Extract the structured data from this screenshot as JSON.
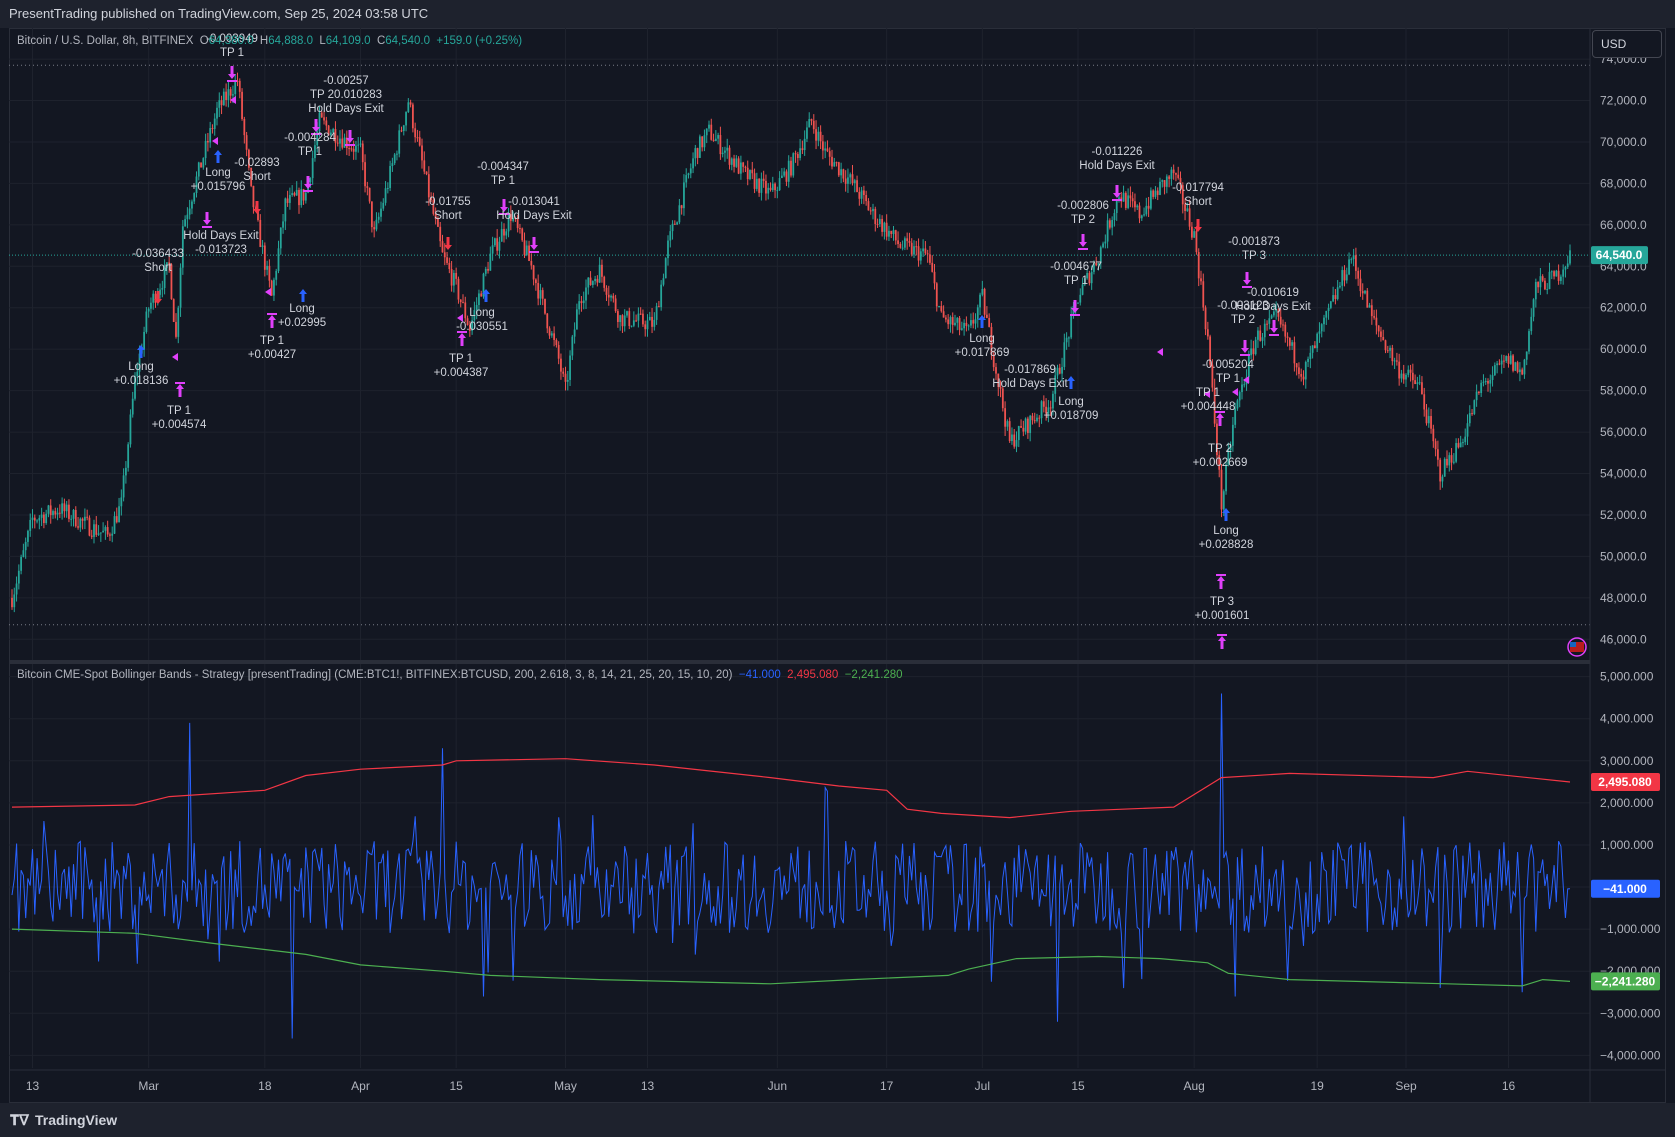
{
  "header": {
    "published": "PresentTrading published on TradingView.com, Sep 25, 2024 03:58 UTC"
  },
  "price_legend": {
    "symbol": "Bitcoin / U.S. Dollar, 8h, BITFINEX",
    "o_label": "O",
    "o_value": "64,380.0",
    "h_label": "H",
    "h_value": "64,888.0",
    "l_label": "L",
    "l_value": "64,109.0",
    "c_label": "C",
    "c_value": "64,540.0",
    "change": "+159.0 (+0.25%)"
  },
  "indicator_legend": {
    "name": "Bitcoin CME-Spot Bollinger Bands - Strategy [presentTrading] (CME:BTC1!, BITFINEX:BTCUSD, 200, 2.618, 3, 8, 14, 21, 25, 20, 15, 10, 20)",
    "value_blue": "−41.000",
    "value_red": "2,495.080",
    "value_green": "−2,241.280"
  },
  "currency_button": "USD",
  "footer": {
    "logo_text": "TradingView"
  },
  "colors": {
    "background": "#131722",
    "up": "#26a69a",
    "down": "#ef5350",
    "grid": "#1e222d",
    "signal_long": "#2962ff",
    "signal_exit": "#e040fb",
    "signal_short": "#f23645",
    "spread": "#2962ff",
    "upper_band": "#f23645",
    "lower_band": "#4caf50"
  },
  "chart_data": [
    {
      "type": "candlestick",
      "title": "Bitcoin / U.S. Dollar, 8h, BITFINEX",
      "ylim": [
        45000,
        75500
      ],
      "y_ticks": [
        "74,000.0",
        "72,000.0",
        "70,000.0",
        "68,000.0",
        "66,000.0",
        "64,000.0",
        "62,000.0",
        "60,000.0",
        "58,000.0",
        "56,000.0",
        "54,000.0",
        "52,000.0",
        "50,000.0",
        "48,000.0",
        "46,000.0"
      ],
      "last_price_label": "64,540.0",
      "x_ticks": [
        "13",
        "Mar",
        "18",
        "Apr",
        "15",
        "May",
        "13",
        "Jun",
        "17",
        "Jul",
        "15",
        "Aug",
        "19",
        "Sep",
        "16"
      ],
      "close_path": [
        [
          "2024-02-10",
          48000
        ],
        [
          "2024-02-13",
          51800
        ],
        [
          "2024-02-17",
          52300
        ],
        [
          "2024-02-21",
          51500
        ],
        [
          "2024-02-24",
          51000
        ],
        [
          "2024-02-26",
          52500
        ],
        [
          "2024-02-28",
          58500
        ],
        [
          "2024-03-01",
          62000
        ],
        [
          "2024-03-04",
          64000
        ],
        [
          "2024-03-05",
          60500
        ],
        [
          "2024-03-06",
          66000
        ],
        [
          "2024-03-08",
          68200
        ],
        [
          "2024-03-11",
          71500
        ],
        [
          "2024-03-14",
          73000
        ],
        [
          "2024-03-16",
          67500
        ],
        [
          "2024-03-19",
          62500
        ],
        [
          "2024-03-21",
          67000
        ],
        [
          "2024-03-24",
          67500
        ],
        [
          "2024-03-26",
          71000
        ],
        [
          "2024-03-28",
          70500
        ],
        [
          "2024-04-01",
          69500
        ],
        [
          "2024-04-03",
          65500
        ],
        [
          "2024-04-05",
          68000
        ],
        [
          "2024-04-08",
          72000
        ],
        [
          "2024-04-10",
          69000
        ],
        [
          "2024-04-13",
          64500
        ],
        [
          "2024-04-15",
          63000
        ],
        [
          "2024-04-17",
          61000
        ],
        [
          "2024-04-20",
          64500
        ],
        [
          "2024-04-23",
          66500
        ],
        [
          "2024-04-26",
          64000
        ],
        [
          "2024-04-30",
          59500
        ],
        [
          "2024-05-01",
          58000
        ],
        [
          "2024-05-03",
          62500
        ],
        [
          "2024-05-06",
          63800
        ],
        [
          "2024-05-09",
          61500
        ],
        [
          "2024-05-14",
          61200
        ],
        [
          "2024-05-16",
          65000
        ],
        [
          "2024-05-20",
          69500
        ],
        [
          "2024-05-22",
          70500
        ],
        [
          "2024-05-27",
          68500
        ],
        [
          "2024-05-31",
          67500
        ],
        [
          "2024-06-03",
          68800
        ],
        [
          "2024-06-06",
          71000
        ],
        [
          "2024-06-08",
          69500
        ],
        [
          "2024-06-12",
          68000
        ],
        [
          "2024-06-15",
          66500
        ],
        [
          "2024-06-19",
          65000
        ],
        [
          "2024-06-23",
          64500
        ],
        [
          "2024-06-25",
          61500
        ],
        [
          "2024-06-29",
          60800
        ],
        [
          "2024-07-01",
          62500
        ],
        [
          "2024-07-05",
          55500
        ],
        [
          "2024-07-08",
          56500
        ],
        [
          "2024-07-11",
          57500
        ],
        [
          "2024-07-15",
          62500
        ],
        [
          "2024-07-18",
          64500
        ],
        [
          "2024-07-21",
          67500
        ],
        [
          "2024-07-24",
          66500
        ],
        [
          "2024-07-27",
          67800
        ],
        [
          "2024-07-29",
          68500
        ],
        [
          "2024-08-01",
          65500
        ],
        [
          "2024-08-03",
          60500
        ],
        [
          "2024-08-05",
          52500
        ],
        [
          "2024-08-07",
          57000
        ],
        [
          "2024-08-10",
          60500
        ],
        [
          "2024-08-13",
          61500
        ],
        [
          "2024-08-17",
          58800
        ],
        [
          "2024-08-20",
          61200
        ],
        [
          "2024-08-24",
          64500
        ],
        [
          "2024-08-27",
          61500
        ],
        [
          "2024-08-31",
          59000
        ],
        [
          "2024-09-03",
          58200
        ],
        [
          "2024-09-06",
          54000
        ],
        [
          "2024-09-09",
          55500
        ],
        [
          "2024-09-12",
          58200
        ],
        [
          "2024-09-16",
          59500
        ],
        [
          "2024-09-18",
          58800
        ],
        [
          "2024-09-20",
          63000
        ],
        [
          "2024-09-23",
          63500
        ],
        [
          "2024-09-25",
          64540
        ]
      ],
      "annotations": [
        {
          "lines": [
            "-0.003949",
            "TP 1"
          ],
          "color": "#d1d4dc"
        },
        {
          "lines": [
            "-0.00257",
            "TP 20.010283",
            "Hold Days Exit"
          ],
          "color": "#d1d4dc"
        },
        {
          "lines": [
            "-0.004284",
            "TP 1"
          ],
          "color": "#d1d4dc"
        },
        {
          "lines": [
            "-0.02893",
            "Short"
          ],
          "color": "#d1d4dc"
        },
        {
          "lines": [
            "Long",
            "+0.015796"
          ],
          "color": "#d1d4dc"
        },
        {
          "lines": [
            "Hold Days Exit",
            "-0.013723"
          ],
          "color": "#d1d4dc"
        },
        {
          "lines": [
            "-0.036433",
            "Short"
          ],
          "color": "#d1d4dc"
        },
        {
          "lines": [
            "Long",
            "+0.018136"
          ],
          "color": "#d1d4dc"
        },
        {
          "lines": [
            "TP 1",
            "+0.004574"
          ],
          "color": "#d1d4dc"
        },
        {
          "lines": [
            "Long",
            "+0.02995"
          ],
          "color": "#d1d4dc"
        },
        {
          "lines": [
            "TP 1",
            "+0.00427"
          ],
          "color": "#d1d4dc"
        },
        {
          "lines": [
            "-0.004347",
            "TP 1"
          ],
          "color": "#d1d4dc"
        },
        {
          "lines": [
            "-0.01755",
            "Short"
          ],
          "color": "#d1d4dc"
        },
        {
          "lines": [
            "-0.013041",
            "Hold Days Exit"
          ],
          "color": "#d1d4dc"
        },
        {
          "lines": [
            "Long",
            "-0.030551"
          ],
          "color": "#d1d4dc"
        },
        {
          "lines": [
            "TP 1",
            "+0.004387"
          ],
          "color": "#d1d4dc"
        },
        {
          "lines": [
            "-0.011226",
            "Hold Days Exit"
          ],
          "color": "#d1d4dc"
        },
        {
          "lines": [
            "-0.002806",
            "TP 2"
          ],
          "color": "#d1d4dc"
        },
        {
          "lines": [
            "-0.017794",
            "Short"
          ],
          "color": "#d1d4dc"
        },
        {
          "lines": [
            "-0.004677",
            "TP 1"
          ],
          "color": "#d1d4dc"
        },
        {
          "lines": [
            "Long",
            "+0.017869"
          ],
          "color": "#d1d4dc"
        },
        {
          "lines": [
            "-0.017869",
            "Hold Days Exit"
          ],
          "color": "#d1d4dc"
        },
        {
          "lines": [
            "Long",
            "+0.018709"
          ],
          "color": "#d1d4dc"
        },
        {
          "lines": [
            "-0.001873",
            "TP 3"
          ],
          "color": "#d1d4dc"
        },
        {
          "lines": [
            "-0.010619",
            "Hold Days Exit"
          ],
          "color": "#d1d4dc"
        },
        {
          "lines": [
            "-0.003123",
            "TP 2"
          ],
          "color": "#d1d4dc"
        },
        {
          "lines": [
            "-0.005204",
            "TP 1"
          ],
          "color": "#d1d4dc"
        },
        {
          "lines": [
            "TP 1",
            "+0.004448"
          ],
          "color": "#d1d4dc"
        },
        {
          "lines": [
            "TP 2",
            "+0.002669"
          ],
          "color": "#d1d4dc"
        },
        {
          "lines": [
            "Long",
            "+0.028828"
          ],
          "color": "#d1d4dc"
        },
        {
          "lines": [
            "TP 3",
            "+0.001601"
          ],
          "color": "#d1d4dc"
        }
      ]
    },
    {
      "type": "line",
      "title": "Bitcoin CME-Spot Bollinger Bands - Strategy [presentTrading]",
      "ylim": [
        -4300,
        5300
      ],
      "y_ticks": [
        "5,000.000",
        "4,000.000",
        "3,000.000",
        "2,000.000",
        "1,000.000",
        "0.000",
        "−1,000.000",
        "−2,000.000",
        "−3,000.000",
        "−4,000.000"
      ],
      "series": [
        {
          "name": "spread",
          "color": "#2962ff",
          "last_label": "−41.000"
        },
        {
          "name": "upper",
          "color": "#f23645",
          "last_label": "2,495.080",
          "values": [
            [
              "2024-02-10",
              1900
            ],
            [
              "2024-02-28",
              1950
            ],
            [
              "2024-03-04",
              2150
            ],
            [
              "2024-03-18",
              2300
            ],
            [
              "2024-03-24",
              2650
            ],
            [
              "2024-04-01",
              2800
            ],
            [
              "2024-04-13",
              2900
            ],
            [
              "2024-04-15",
              3000
            ],
            [
              "2024-05-01",
              3050
            ],
            [
              "2024-05-14",
              2900
            ],
            [
              "2024-05-31",
              2600
            ],
            [
              "2024-06-10",
              2400
            ],
            [
              "2024-06-17",
              2300
            ],
            [
              "2024-06-20",
              1850
            ],
            [
              "2024-06-25",
              1750
            ],
            [
              "2024-07-05",
              1650
            ],
            [
              "2024-07-14",
              1800
            ],
            [
              "2024-07-29",
              1900
            ],
            [
              "2024-08-05",
              2600
            ],
            [
              "2024-08-15",
              2700
            ],
            [
              "2024-09-05",
              2600
            ],
            [
              "2024-09-10",
              2750
            ],
            [
              "2024-09-25",
              2495
            ]
          ]
        },
        {
          "name": "lower",
          "color": "#4caf50",
          "last_label": "−2,241.280",
          "values": [
            [
              "2024-02-10",
              -1000
            ],
            [
              "2024-02-28",
              -1100
            ],
            [
              "2024-03-11",
              -1350
            ],
            [
              "2024-03-24",
              -1600
            ],
            [
              "2024-04-01",
              -1850
            ],
            [
              "2024-04-13",
              -2000
            ],
            [
              "2024-04-20",
              -2100
            ],
            [
              "2024-05-06",
              -2200
            ],
            [
              "2024-05-31",
              -2300
            ],
            [
              "2024-06-12",
              -2200
            ],
            [
              "2024-06-26",
              -2100
            ],
            [
              "2024-06-29",
              -1950
            ],
            [
              "2024-07-06",
              -1700
            ],
            [
              "2024-07-18",
              -1650
            ],
            [
              "2024-07-27",
              -1700
            ],
            [
              "2024-08-03",
              -1800
            ],
            [
              "2024-08-06",
              -2050
            ],
            [
              "2024-08-15",
              -2200
            ],
            [
              "2024-09-07",
              -2300
            ],
            [
              "2024-09-18",
              -2350
            ],
            [
              "2024-09-21",
              -2200
            ],
            [
              "2024-09-25",
              -2241
            ]
          ]
        }
      ]
    }
  ]
}
